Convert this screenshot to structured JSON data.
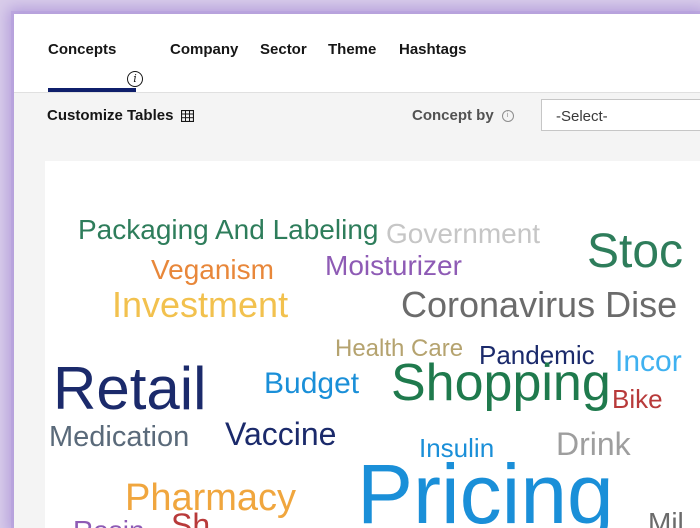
{
  "tabs": {
    "concepts": "Concepts",
    "company": "Company",
    "sector": "Sector",
    "theme": "Theme",
    "hashtags": "Hashtags"
  },
  "toolbar": {
    "customize_label": "Customize Tables",
    "concept_by_label": "Concept by",
    "select_value": "-Select-"
  },
  "word_cloud": {
    "packaging": "Packaging And Labeling",
    "government": "Government",
    "stock": "Stoc",
    "veganism": "Veganism",
    "moisturizer": "Moisturizer",
    "investment": "Investment",
    "coronavirus": "Coronavirus Dise",
    "health_care": "Health Care",
    "pandemic": "Pandemic",
    "income": "Incor",
    "retail": "Retail",
    "budget": "Budget",
    "shopping": "Shopping",
    "bike": "Bike",
    "medication": "Medication",
    "vaccine": "Vaccine",
    "insulin": "Insulin",
    "drink": "Drink",
    "pharmacy": "Pharmacy",
    "pricing": "Pricing",
    "mil": "Mil",
    "bottom_left_1": "Rasin",
    "bottom_left_2": "Sh"
  },
  "colors": {
    "underline": "#0f1f6b",
    "navy": "#1b2a6b",
    "teal_green": "#2e7d5b",
    "blue": "#1a8fd8",
    "orange": "#e8873a",
    "yellow": "#f2c14e",
    "purple": "#8e5bb5",
    "grey": "#6b6b6b",
    "tan": "#b5a36f",
    "red": "#b83a3a"
  }
}
